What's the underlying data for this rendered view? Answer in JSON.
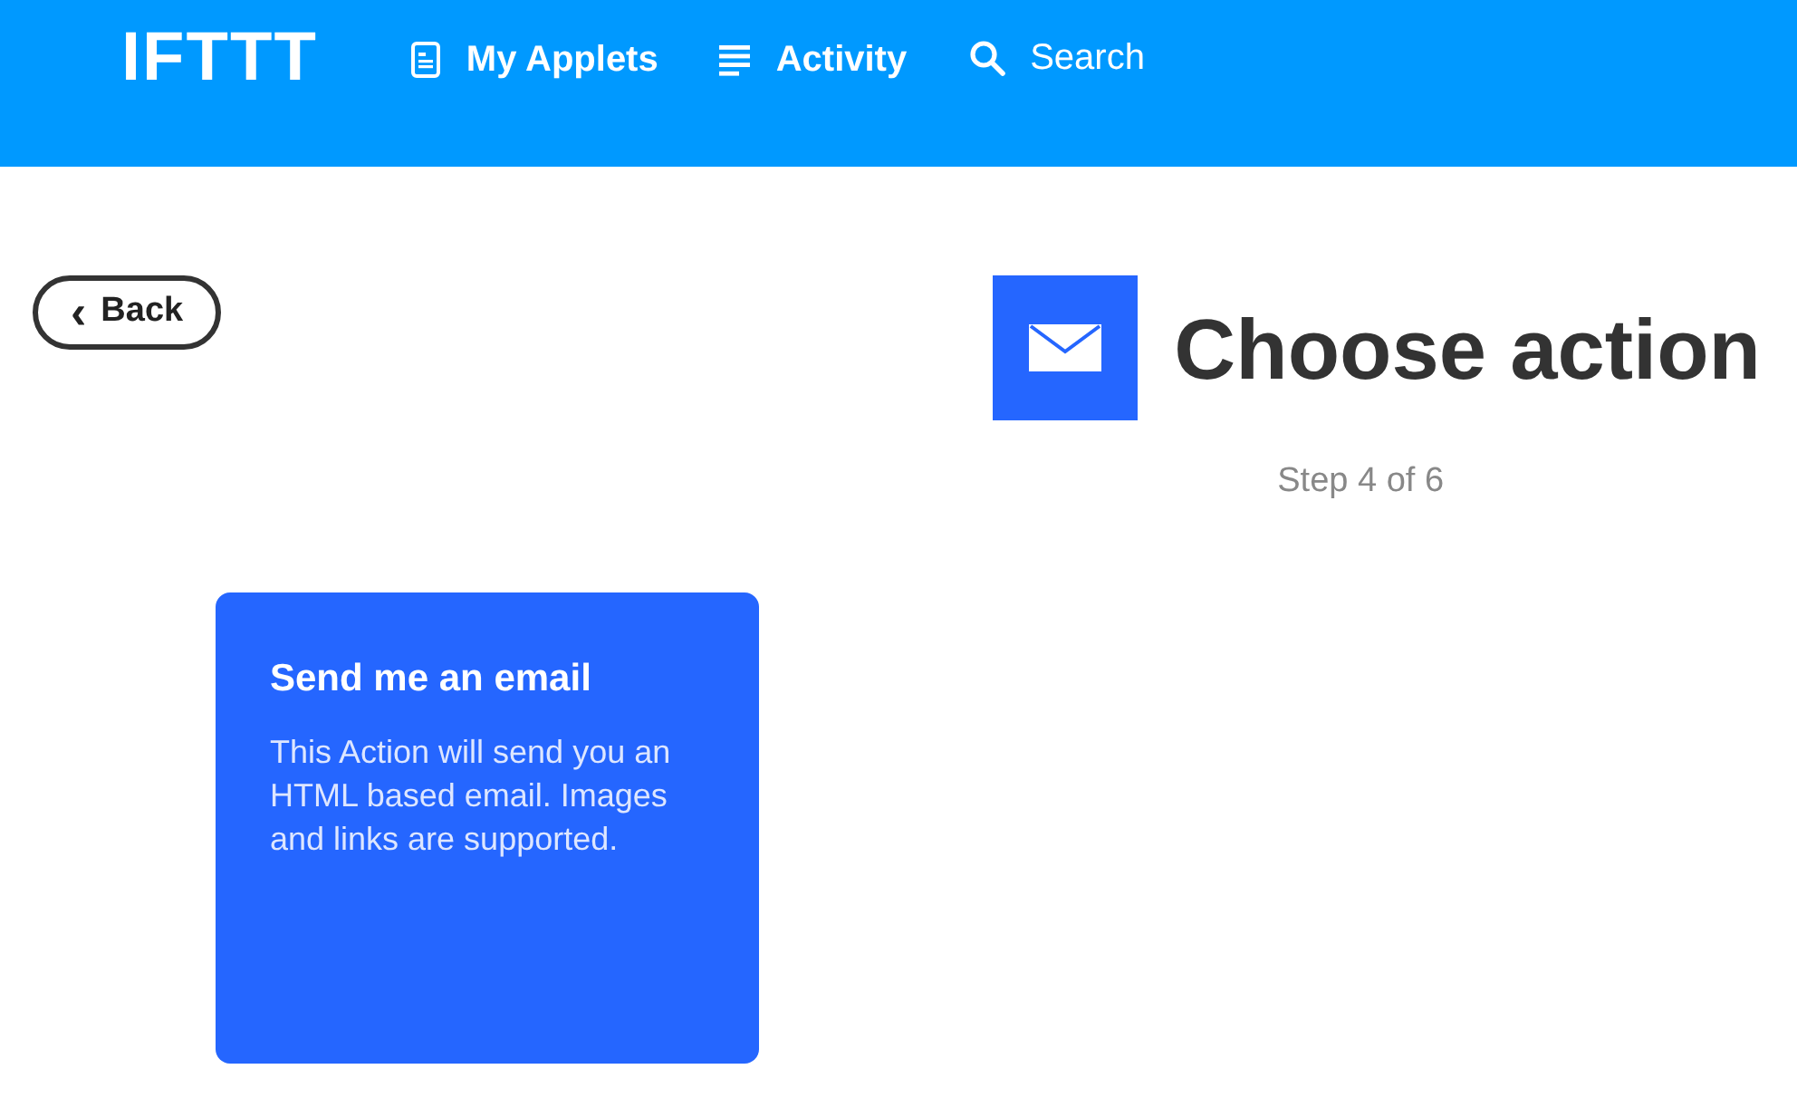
{
  "header": {
    "logo": "IFTTT",
    "nav": [
      {
        "kind": "applets",
        "label": "My Applets"
      },
      {
        "kind": "activity",
        "label": "Activity"
      },
      {
        "kind": "search",
        "label": "Search"
      }
    ]
  },
  "back_button": {
    "icon": "‹",
    "label": "Back"
  },
  "title": "Choose action",
  "step": "Step 4 of 6",
  "actions": [
    {
      "title": "Send me an email",
      "description": "This Action will send you an HTML based email. Images and links are supported."
    }
  ]
}
